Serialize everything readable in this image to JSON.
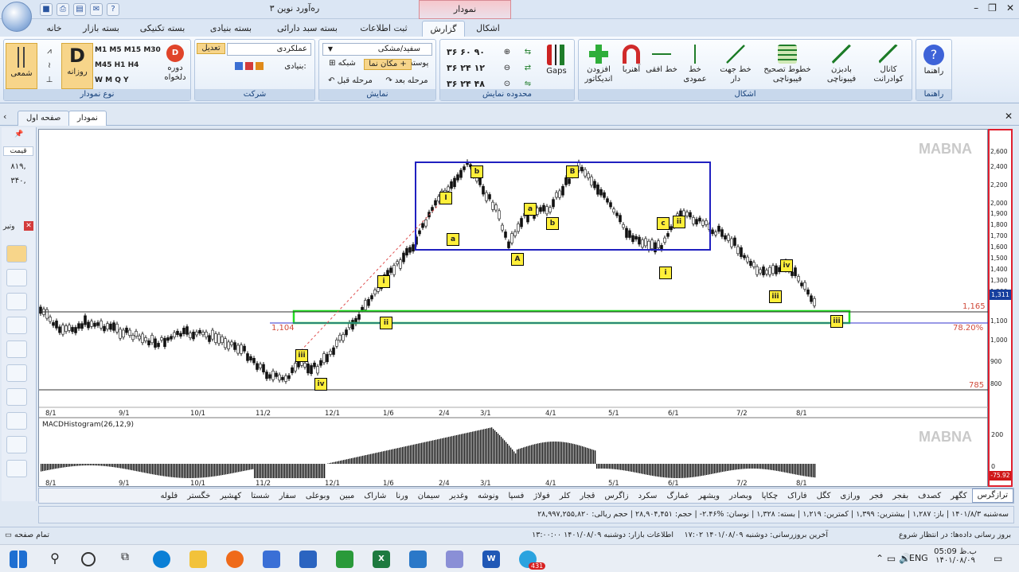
{
  "window": {
    "title": "ره‌آورد نوین ۳",
    "context_group": "نمودار",
    "controls": [
      "–",
      "❐",
      "✕"
    ]
  },
  "ribbon_tabs": [
    "خانه",
    "بسته بازار",
    "بسته تکنیکی",
    "بسته بنیادی",
    "بسته سبد دارائی",
    "ثبت اطلاعات",
    "گزارش",
    "اشکال"
  ],
  "active_tab": "گزارش",
  "groups": {
    "chart_type": {
      "label": "نوع نمودار",
      "candle": "شمعی",
      "daily_letter": "D",
      "daily": "روزانه",
      "period": "دوره دلخواه",
      "periods": [
        "M1",
        "M5",
        "M15",
        "M30",
        "M45",
        "H1",
        "H4",
        "W",
        "M",
        "Q",
        "Y"
      ]
    },
    "company": {
      "label": "شرکت",
      "edit": "تعدیل",
      "name": "عملکردی",
      "fundamental": "بنیادی:"
    },
    "display": {
      "label": "نمایش",
      "theme": "سفید/مشکی",
      "background": "پوسته",
      "cursor": "مکان نما",
      "grid": "شبکه",
      "next": "مرحله بعد",
      "prev": "مرحله قبل"
    },
    "range": {
      "label": "محدوده نمایش",
      "nums": [
        "۳۶",
        "۶۰",
        "۹۰",
        "۳۶",
        "۲۴",
        "۱۲",
        "۳۶",
        "۲۴",
        "۴۸"
      ],
      "gaps": "Gaps"
    },
    "shapes": {
      "label": "اشکال",
      "add": "افزودن اندیکاتور",
      "magnet": "آهنربا",
      "hline": "خط افقی",
      "vline": "خط عمودی",
      "trend": "خط جهت دار",
      "fib": "خطوط تصحیح فیبوناچی",
      "fan": "بادبزن فیبوناچی",
      "channel": "کانال کوادرانت"
    },
    "help": {
      "label": "راهنما",
      "btn": "راهنما"
    }
  },
  "doc_tabs": [
    "صفحه اول",
    "نمودار"
  ],
  "chart": {
    "watermark": "MABNA",
    "x_labels": [
      "8/1",
      "9/1",
      "10/1",
      "11/2",
      "12/1",
      "1/6",
      "2/4",
      "3/1",
      "4/1",
      "5/1",
      "6/1",
      "7/2",
      "8/1"
    ],
    "y_ticks": [
      "2,600",
      "2,400",
      "2,200",
      "2,000",
      "1,900",
      "1,800",
      "1,700",
      "1,600",
      "1,500",
      "1,400",
      "1,300",
      "1,200",
      "1,100",
      "1,000",
      "900",
      "800"
    ],
    "price_badge": "1,311",
    "levels": {
      "upper": "1,165",
      "fib_pct": "78.20%",
      "left": "1,104",
      "lower": "785"
    },
    "wave_labels": [
      "i",
      "ii",
      "iii",
      "iv",
      "I",
      "a",
      "b",
      "A",
      "a",
      "b",
      "B",
      "c",
      "ii",
      "i",
      "iii",
      "iv",
      "iii"
    ],
    "macd_title": "MACDHistogram(26,12,9)",
    "macd_badge": "-75.92",
    "macd_ticks": [
      "200",
      "0"
    ]
  },
  "left_panel": {
    "price": "قیمت",
    "v1": "۸۱۹,",
    "v2": "۳۴۰,",
    "label": "وتیر"
  },
  "symbols": [
    "ترازگرس",
    "کگهر",
    "کصدف",
    "بفجر",
    "فجر",
    "ورازی",
    "کگل",
    "فاراک",
    "چکاپا",
    "وبصادر",
    "ویشهر",
    "غمارگ",
    "سکرد",
    "زاگرس",
    "قجار",
    "کلر",
    "فولاژ",
    "فسپا",
    "ونوشه",
    "وغدیر",
    "سیمان",
    "ورنا",
    "شاراک",
    "مبین",
    "وبوعلی",
    "سفار",
    "شستا",
    "کهشیر",
    "خگستر",
    "فلوله"
  ],
  "stats": "سه‌شنبه ۱۴۰۱/۸/۳ | باز: ۱,۲۸۷ | بیشترین: ۱,۳۹۹ | کمترین: ۱,۲۱۹ | بسته: ۱,۳۲۸ | نوسان: %۲.۴۶- | حجم: ۲۸,۹۰۴,۴۵۱ | حجم ریالی: ۲۸,۹۹۷,۲۵۵,۸۲۰",
  "status": {
    "left": "تمام صفحه",
    "update": "بروز رسانی داده‌ها: در انتظار شروع",
    "last": "آخرین بروزرسانی: دوشنبه ۱۴۰۱/۰۸/۰۹ ۱۷:۰۲",
    "market": "اطلاعات بازار: دوشنبه ۱۴۰۱/۰۸/۰۹ ۱۳:۰۰:۰۰"
  },
  "taskbar": {
    "time": "05:09 ب.ظ",
    "date": "۱۴۰۱/۰۸/۰۹",
    "lang": "ENG",
    "badge": "431"
  }
}
